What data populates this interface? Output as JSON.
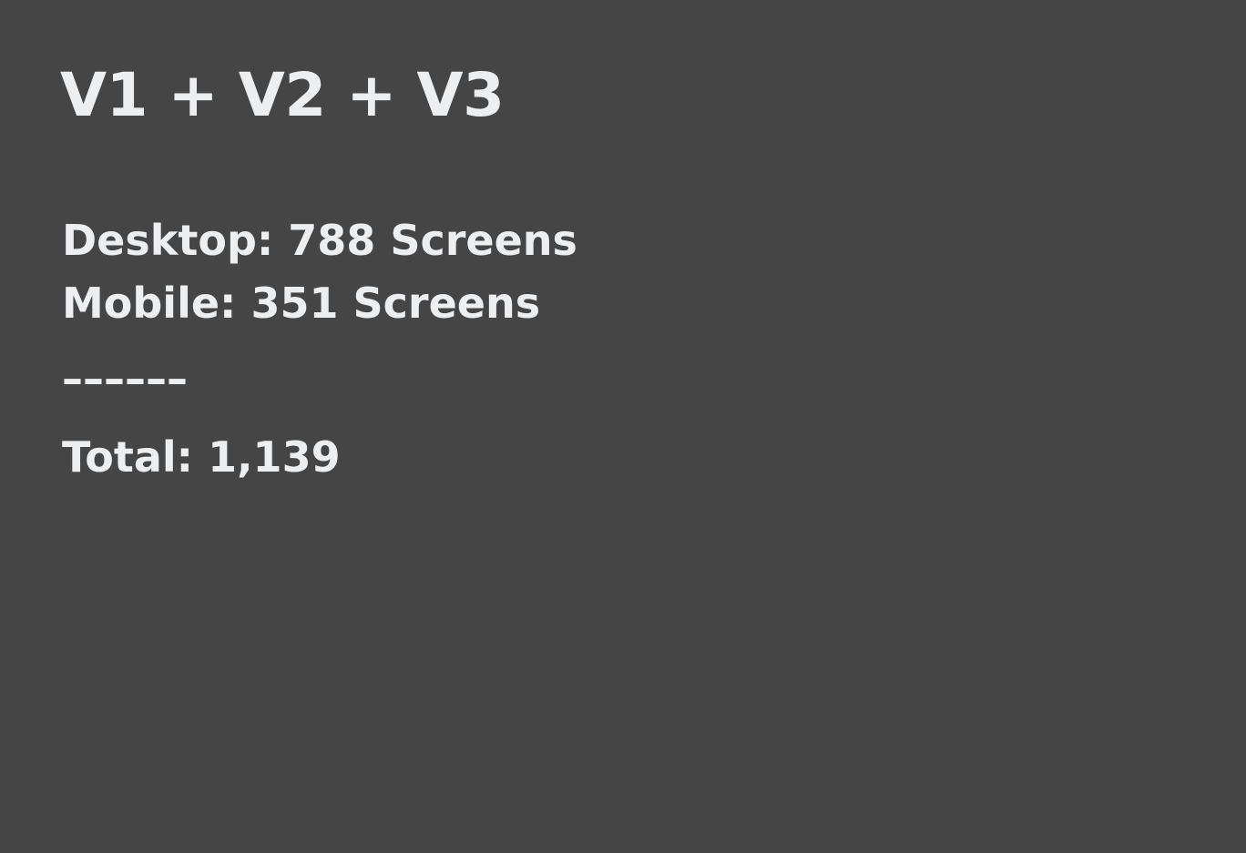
{
  "slide": {
    "title": "V1 + V2 + V3",
    "desktop_line": "Desktop: 788 Screens",
    "mobile_line": "Mobile: 351 Screens",
    "divider": "––––––",
    "total_line": "Total: 1,139"
  },
  "colors": {
    "background": "#454545",
    "text": "#EDEEF0"
  }
}
